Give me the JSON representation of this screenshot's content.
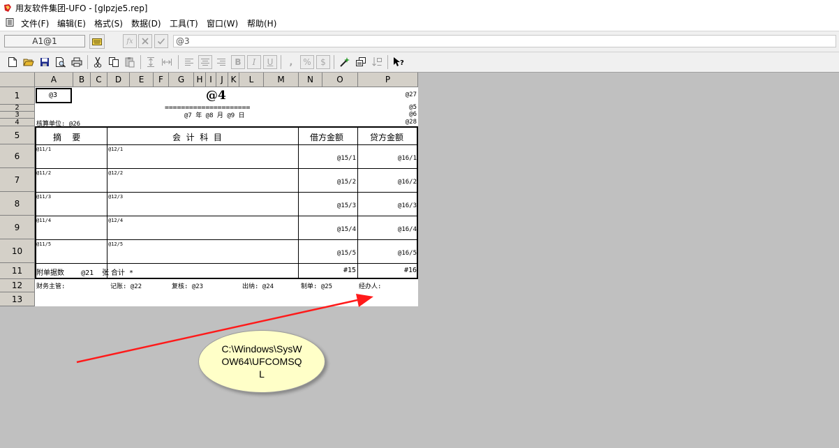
{
  "window": {
    "title": "用友软件集团-UFO - [glpzje5.rep]"
  },
  "menu": [
    "文件(F)",
    "编辑(E)",
    "格式(S)",
    "数据(D)",
    "工具(T)",
    "窗口(W)",
    "帮助(H)"
  ],
  "editbar": {
    "cell_ref": "A1@1",
    "fx_label": "fx",
    "formula_value": "@3"
  },
  "columns": [
    "A",
    "B",
    "C",
    "D",
    "E",
    "F",
    "G",
    "H",
    "I",
    "J",
    "K",
    "L",
    "M",
    "N",
    "O",
    "P"
  ],
  "rows": [
    "1",
    "2",
    "3",
    "4",
    "5",
    "6",
    "7",
    "8",
    "9",
    "10",
    "11",
    "12",
    "13"
  ],
  "report": {
    "a1": "@3",
    "title": "@4",
    "p1": "@27",
    "underline": "=====================",
    "p2": "@5",
    "date": "@7 年 @8 月 @9 日",
    "p3": "@6",
    "unit": "核算单位: @26",
    "p4": "@28",
    "header": {
      "summary": "摘    要",
      "account": "会  计  科  目",
      "debit": "借方金额",
      "credit": "贷方金额"
    },
    "lines": [
      {
        "summary": "@11/1",
        "account": "@12/1",
        "debit": "@15/1",
        "credit": "@16/1"
      },
      {
        "summary": "@11/2",
        "account": "@12/2",
        "debit": "@15/2",
        "credit": "@16/2"
      },
      {
        "summary": "@11/3",
        "account": "@12/3",
        "debit": "@15/3",
        "credit": "@16/3"
      },
      {
        "summary": "@11/4",
        "account": "@12/4",
        "debit": "@15/4",
        "credit": "@16/4"
      },
      {
        "summary": "@11/5",
        "account": "@12/5",
        "debit": "@15/5",
        "credit": "@16/5"
      }
    ],
    "attachments": "附单据数    @21  张",
    "total_label": "合计 *",
    "total_debit": "#15",
    "total_credit": "#16",
    "footer": [
      "财务主管:",
      "记账: @22",
      "复核: @23",
      "出纳: @24",
      "制单: @25",
      "经办人:"
    ]
  },
  "callout": {
    "text": "C:\\Windows\\SysWOW64\\UFCOMSQL"
  }
}
